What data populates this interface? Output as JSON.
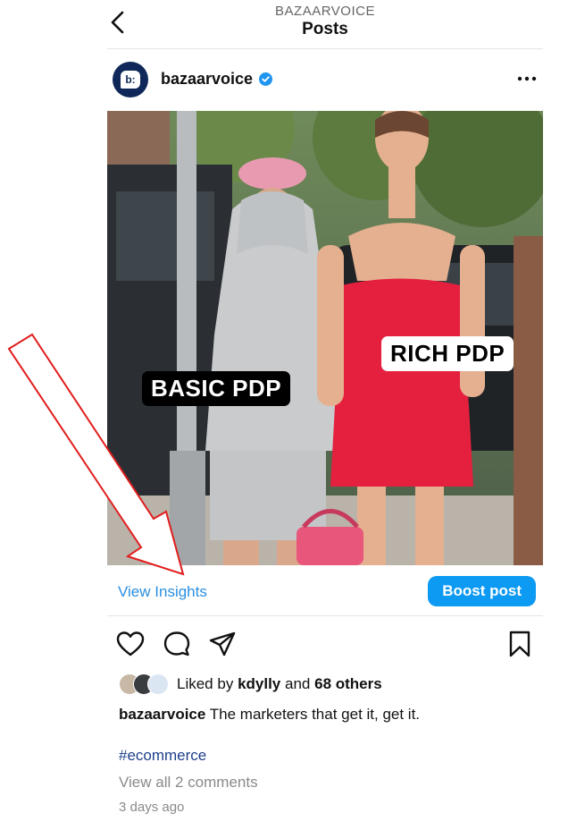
{
  "header": {
    "subtitle": "BAZAARVOICE",
    "title": "Posts",
    "back_icon": "chevron-left-icon"
  },
  "account": {
    "username": "bazaarvoice",
    "avatar_text": "b:",
    "verified_icon": "verified-badge-icon",
    "more_icon": "more-horizontal-icon",
    "brand_color": "#0f2859"
  },
  "post": {
    "overlay_labels": {
      "basic": "BASIC PDP",
      "rich": "RICH PDP"
    }
  },
  "actions": {
    "view_insights": "View Insights",
    "boost_post": "Boost post",
    "like_icon": "heart-icon",
    "comment_icon": "comment-icon",
    "share_icon": "send-icon",
    "save_icon": "bookmark-icon",
    "accent_color": "#0d9af2"
  },
  "likes": {
    "prefix": "Liked by",
    "user": "kdylly",
    "joiner": "and",
    "others": "68 others"
  },
  "caption": {
    "username": "bazaarvoice",
    "text": "The marketers that get it, get it."
  },
  "hashtag": "#ecommerce",
  "view_comments": "View all 2 comments",
  "timestamp": "3 days ago"
}
